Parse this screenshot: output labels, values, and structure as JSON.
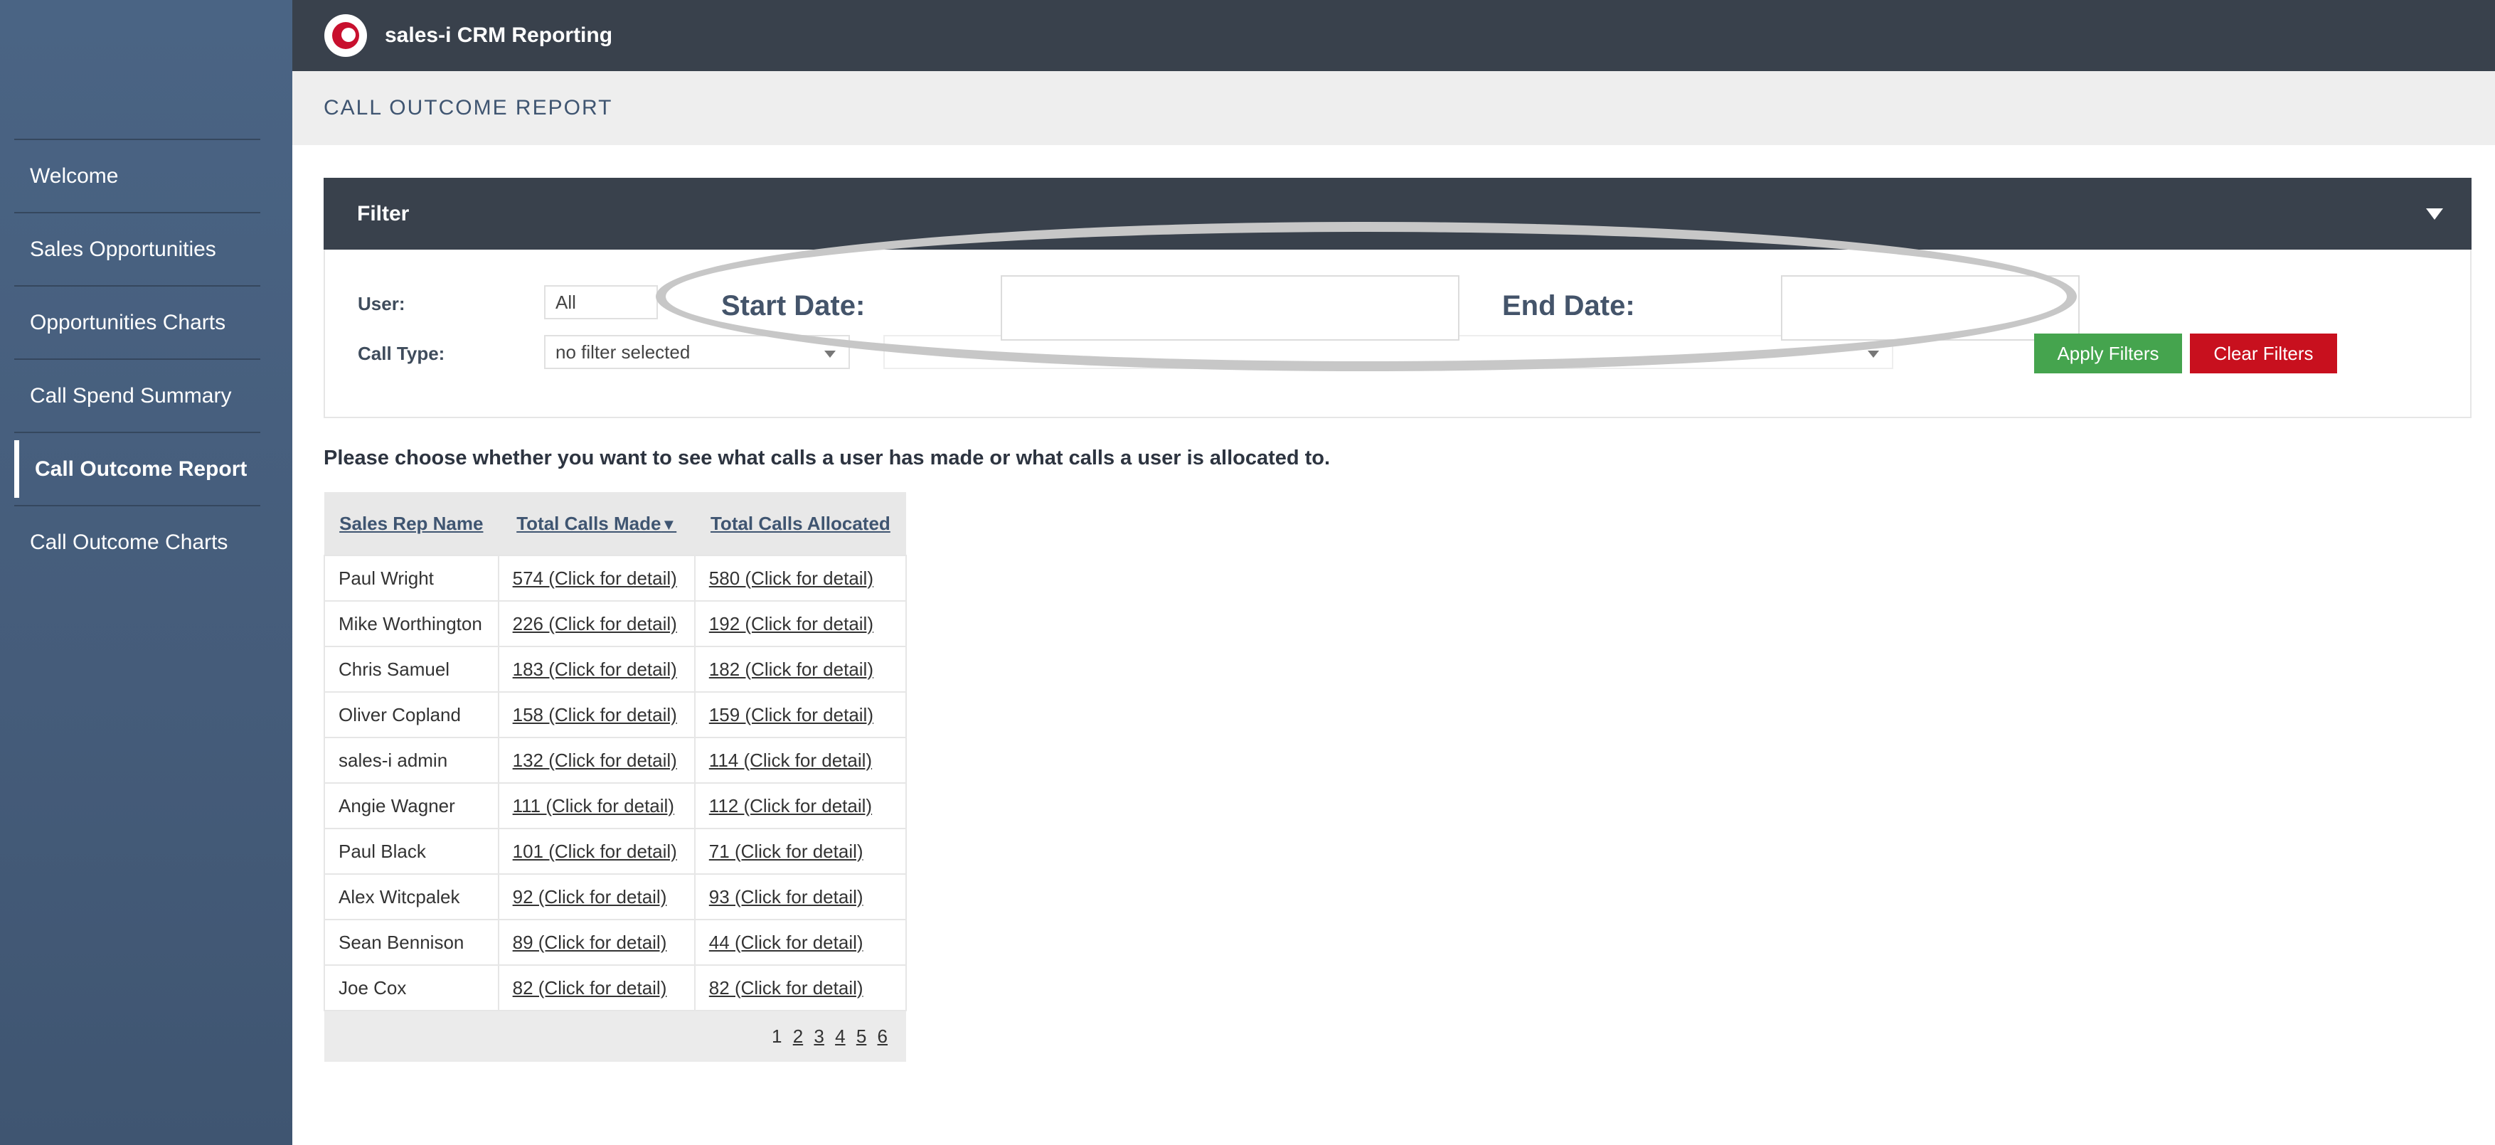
{
  "app": {
    "title": "sales-i CRM Reporting",
    "logo": "sales-i-logo"
  },
  "sidebar": {
    "items": [
      {
        "label": "Welcome",
        "active": false
      },
      {
        "label": "Sales Opportunities",
        "active": false
      },
      {
        "label": "Opportunities Charts",
        "active": false
      },
      {
        "label": "Call Spend Summary",
        "active": false
      },
      {
        "label": "Call Outcome Report",
        "active": true
      },
      {
        "label": "Call Outcome Charts",
        "active": false
      }
    ]
  },
  "page": {
    "title": "CALL OUTCOME REPORT"
  },
  "filter": {
    "title": "Filter",
    "user_label": "User:",
    "user_value": "All",
    "call_type_label": "Call Type:",
    "call_type_value": "no filter selected",
    "start_date_label": "Start Date:",
    "end_date_label": "End Date:",
    "start_date_value": "",
    "end_date_value": "",
    "apply_label": "Apply Filters",
    "clear_label": "Clear Filters"
  },
  "instructions": "Please choose whether you want to see what calls a user has made or what calls a user is allocated to.",
  "table": {
    "headers": [
      "Sales Rep Name",
      "Total Calls Made",
      "Total Calls Allocated"
    ],
    "sort_indicator": "▼",
    "rows": [
      {
        "name": "Paul Wright",
        "made": "574 (Click for detail)",
        "allocated": "580 (Click for detail)"
      },
      {
        "name": "Mike Worthington",
        "made": "226 (Click for detail)",
        "allocated": "192 (Click for detail)"
      },
      {
        "name": "Chris Samuel",
        "made": "183 (Click for detail)",
        "allocated": "182 (Click for detail)"
      },
      {
        "name": "Oliver Copland",
        "made": "158 (Click for detail)",
        "allocated": "159 (Click for detail)"
      },
      {
        "name": "sales-i admin",
        "made": "132 (Click for detail)",
        "allocated": "114 (Click for detail)"
      },
      {
        "name": "Angie Wagner",
        "made": "111 (Click for detail)",
        "allocated": "112 (Click for detail)"
      },
      {
        "name": "Paul Black",
        "made": "101 (Click for detail)",
        "allocated": "71 (Click for detail)"
      },
      {
        "name": "Alex Witcpalek",
        "made": "92 (Click for detail)",
        "allocated": "93 (Click for detail)"
      },
      {
        "name": "Sean Bennison",
        "made": "89 (Click for detail)",
        "allocated": "44 (Click for detail)"
      },
      {
        "name": "Joe Cox",
        "made": "82 (Click for detail)",
        "allocated": "82 (Click for detail)"
      }
    ],
    "pagination": [
      "1",
      "2",
      "3",
      "4",
      "5",
      "6"
    ],
    "current_page": "1"
  }
}
